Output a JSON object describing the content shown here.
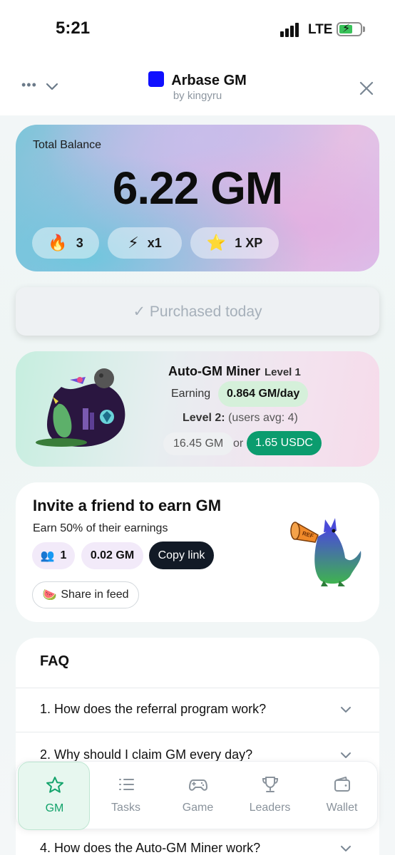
{
  "status_bar": {
    "time": "5:21",
    "network": "LTE"
  },
  "app_header": {
    "title": "Arbase GM",
    "subtitle": "by kingyru"
  },
  "balance": {
    "label": "Total Balance",
    "value": "6.22 GM",
    "stats": [
      {
        "icon": "fire-icon",
        "emoji": "🔥",
        "value": "3"
      },
      {
        "icon": "lightning-icon",
        "emoji": "⚡",
        "value": "x1"
      },
      {
        "icon": "star-icon",
        "emoji": "⭐",
        "value": "1 XP"
      }
    ]
  },
  "purchase_button": {
    "label": "✓ Purchased today"
  },
  "miner": {
    "title": "Auto-GM Miner",
    "level": "Level 1",
    "earning_label": "Earning",
    "earning_value": "0.864 GM/day",
    "next_level_label": "Level 2:",
    "next_level_note": "(users avg: 4)",
    "price_gm": "16.45 GM",
    "or_label": "or",
    "price_usdc": "1.65 USDC"
  },
  "invite": {
    "title": "Invite a friend to earn GM",
    "subtitle": "Earn 50% of their earnings",
    "friends_emoji": "👥",
    "friends_count": "1",
    "earned": "0.02 GM",
    "copy_label": "Copy link",
    "share_emoji": "🍉",
    "share_label": "Share in feed",
    "mascot_sign": "REF"
  },
  "faq": {
    "title": "FAQ",
    "items": [
      "1. How does the referral program work?",
      "2. Why should I claim GM every day?",
      "4. How does the Auto-GM Miner work?"
    ]
  },
  "nav": {
    "items": [
      {
        "label": "GM",
        "icon": "star-icon",
        "active": true
      },
      {
        "label": "Tasks",
        "icon": "list-icon",
        "active": false
      },
      {
        "label": "Game",
        "icon": "gamepad-icon",
        "active": false
      },
      {
        "label": "Leaders",
        "icon": "trophy-icon",
        "active": false
      },
      {
        "label": "Wallet",
        "icon": "wallet-icon",
        "active": false
      }
    ]
  },
  "colors": {
    "accent_green": "#13a36b",
    "usdc_button": "#0b9c6e",
    "app_icon": "#1010ff",
    "copy_button": "#121a26"
  }
}
